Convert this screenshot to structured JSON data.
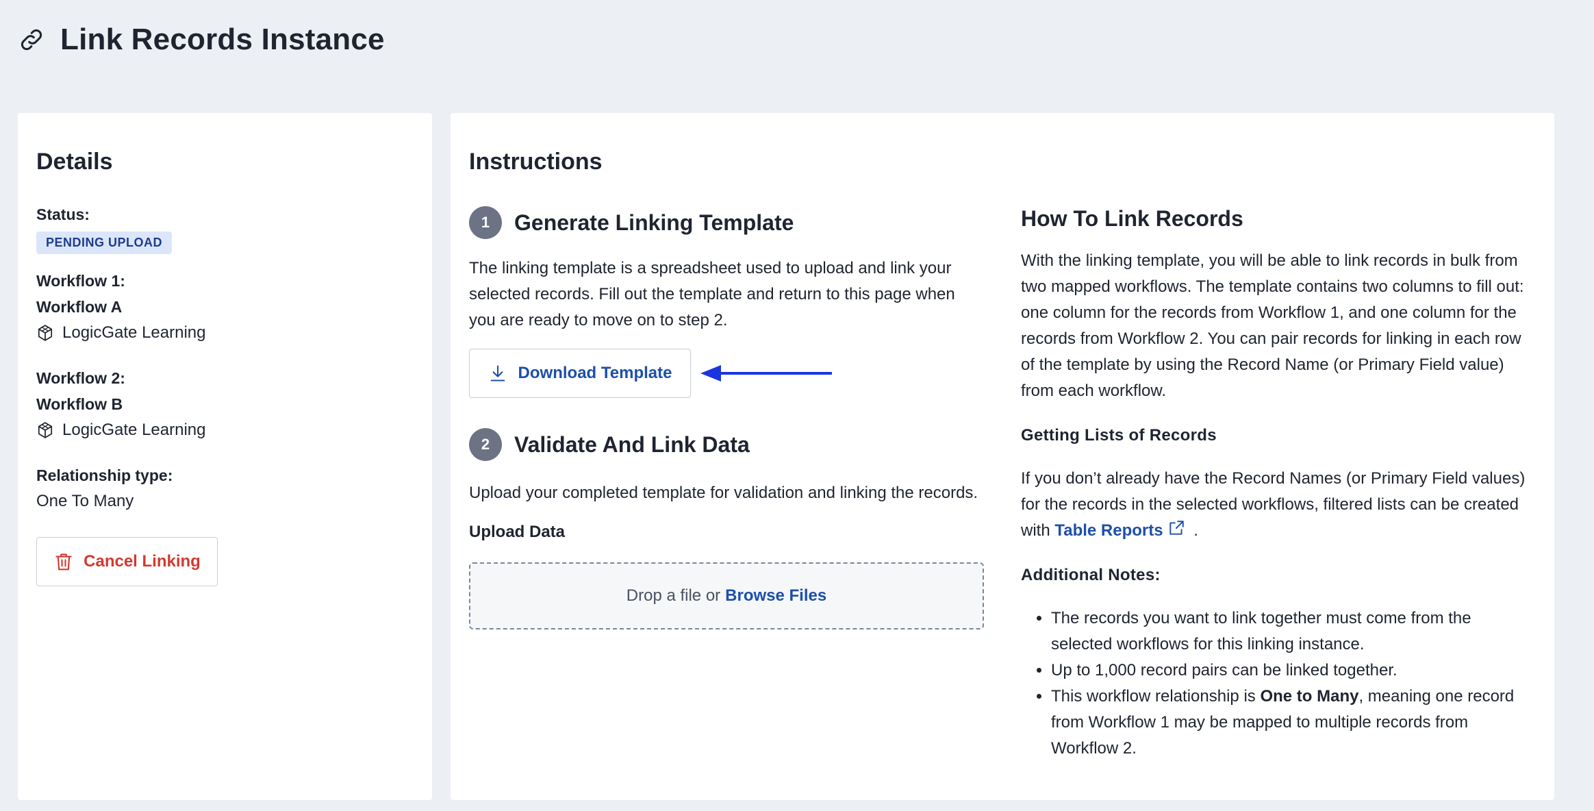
{
  "header": {
    "title": "Link Records Instance",
    "icon": "link-icon"
  },
  "details": {
    "title": "Details",
    "status_label": "Status:",
    "status_value": "PENDING UPLOAD",
    "workflow1_label": "Workflow 1:",
    "workflow1_name": "Workflow A",
    "workflow1_app": "LogicGate Learning",
    "workflow2_label": "Workflow 2:",
    "workflow2_name": "Workflow B",
    "workflow2_app": "LogicGate Learning",
    "relationship_label": "Relationship type:",
    "relationship_value": "One To Many",
    "cancel_label": "Cancel Linking"
  },
  "instructions": {
    "title": "Instructions",
    "step1": {
      "number": "1",
      "title": "Generate Linking Template",
      "text": "The linking template is a spreadsheet used to upload and link your selected records. Fill out the template and return to this page when you are ready to move on to step 2.",
      "download_label": "Download Template"
    },
    "step2": {
      "number": "2",
      "title": "Validate And Link Data",
      "text": "Upload your completed template for validation and linking the records.",
      "upload_label": "Upload Data",
      "drop_text": "Drop a file or",
      "browse_label": "Browse Files"
    },
    "how_to": {
      "title": "How To Link Records",
      "text": "With the linking template, you will be able to link records in bulk from two mapped workflows. The template contains two columns to fill out: one column for the records from Workflow 1, and one column for the records from Workflow 2. You can pair records for linking in each row of the template by using the Record Name (or Primary Field value) from each workflow.",
      "lists_title": "Getting Lists of Records",
      "lists_text": "If you don’t already have the Record Names (or Primary Field values) for the records in the selected workflows, filtered lists can be created with",
      "table_reports_link": "Table Reports",
      "lists_text_end": ".",
      "notes_title": "Additional Notes:",
      "note1": "The records you want to link together must come from the selected workflows for this linking instance.",
      "note2": "Up to 1,000 record pairs can be linked together.",
      "note3_pre": "This workflow relationship is",
      "note3_bold": "One to Many",
      "note3_post": ", meaning one record from Workflow 1 may be mapped to multiple records from Workflow 2."
    }
  },
  "colors": {
    "accent": "#1d4fa8",
    "danger": "#d23a2f",
    "badge_bg": "#dce6fa",
    "arrow": "#1a35e0"
  }
}
